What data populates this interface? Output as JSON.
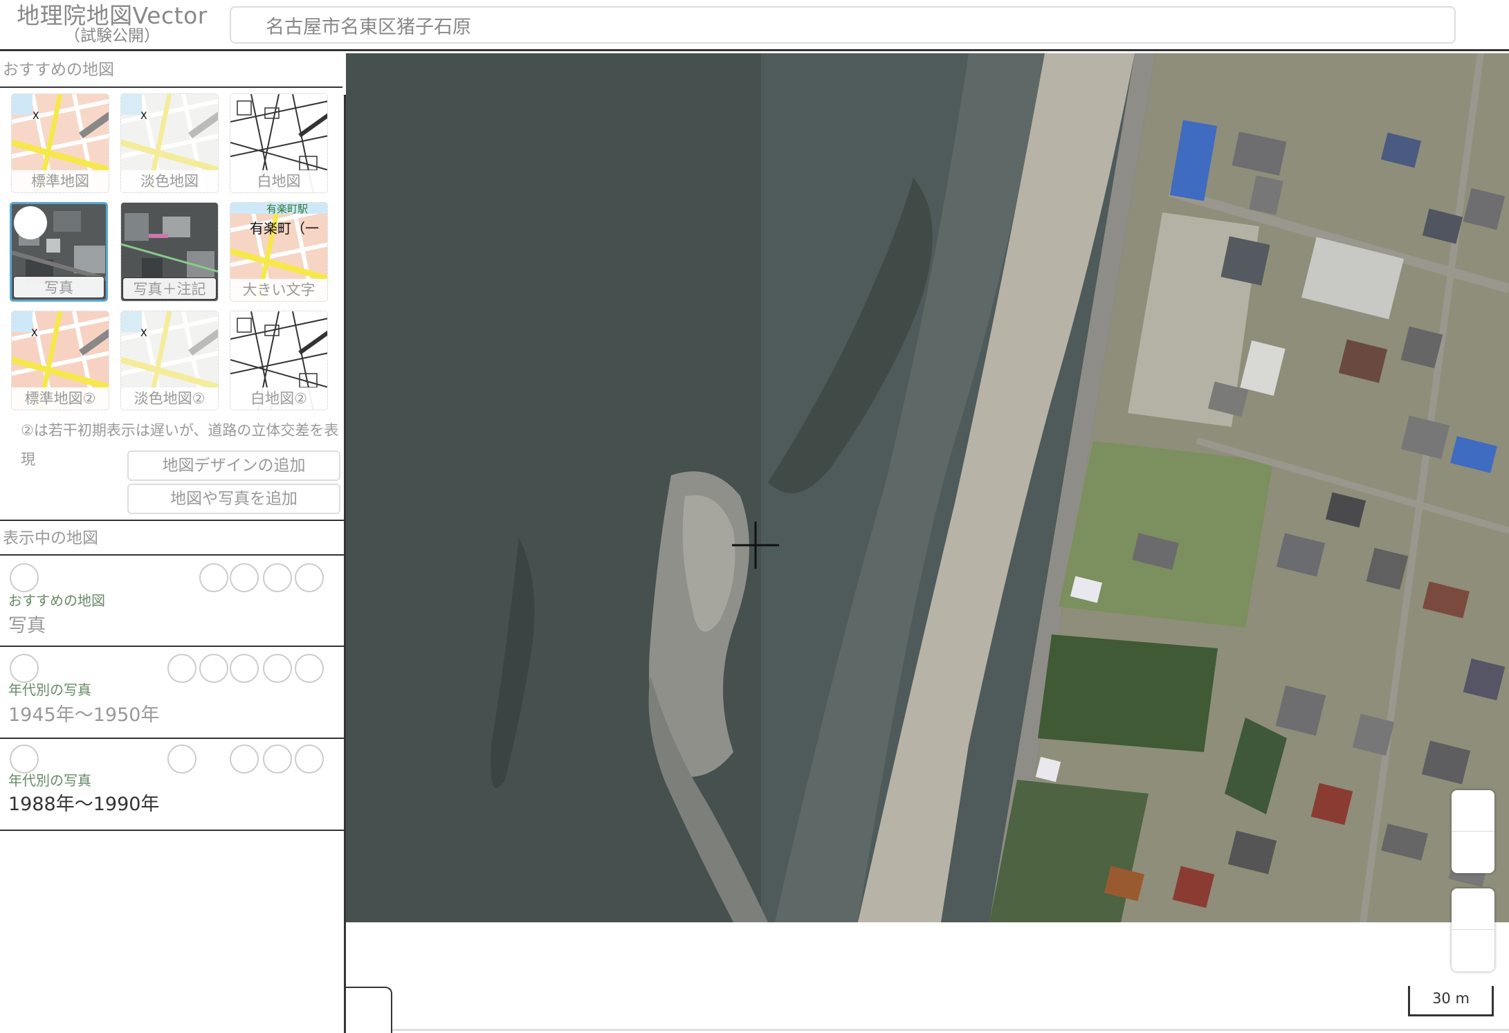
{
  "header": {
    "title": "地理院地図Vector",
    "subtitle": "（試験公開）",
    "search_value": "名古屋市名東区猪子石原"
  },
  "recommended": {
    "title": "おすすめの地図",
    "maps": [
      {
        "label": "標準地図",
        "style": "std"
      },
      {
        "label": "淡色地図",
        "style": "pale"
      },
      {
        "label": "白地図",
        "style": "blank"
      },
      {
        "label": "写真",
        "style": "photo",
        "selected": true
      },
      {
        "label": "写真＋注記",
        "style": "photo-label"
      },
      {
        "label": "大きい文字",
        "style": "large-text"
      },
      {
        "label": "標準地図②",
        "style": "std"
      },
      {
        "label": "淡色地図②",
        "style": "pale"
      },
      {
        "label": "白地図②",
        "style": "blank"
      }
    ],
    "note": "②は若干初期表示は遅いが、道路の立体交差を表現",
    "add_design_label": "地図デザインの追加",
    "add_photo_label": "地図や写真を追加"
  },
  "shown": {
    "title": "表示中の地図",
    "layers": [
      {
        "category": "おすすめの地図",
        "name": "写真",
        "name_style": "gray"
      },
      {
        "category": "年代別の写真",
        "name": "1945年～1950年",
        "name_style": "gray"
      },
      {
        "category": "年代別の写真",
        "name": "1988年～1990年",
        "name_style": "dark"
      }
    ]
  },
  "thumb_text": {
    "large_text_station": "有楽町（一",
    "large_text_top": "有楽町駅"
  },
  "map": {
    "scale_label": "30 m"
  },
  "colors": {
    "water": "#4f5a5a",
    "sand": "#b7b3a6",
    "selected_border": "#5aa6d6",
    "category_green": "#668a66"
  }
}
